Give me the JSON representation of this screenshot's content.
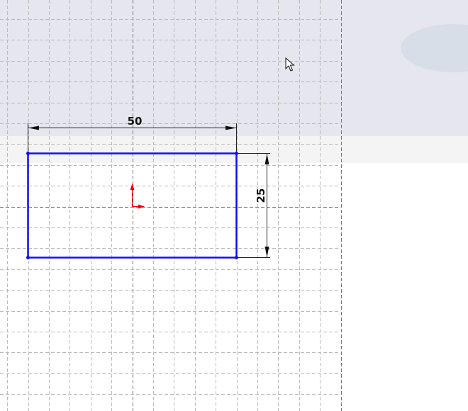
{
  "sketch": {
    "width_dimension": "50",
    "height_dimension": "25",
    "sketch_line_color": "#1010ee",
    "origin_color": "#ee0000",
    "background_color": "#e5e6ee"
  },
  "icons": {
    "cursor": "arrow-pointer-icon",
    "origin": "sketch-origin-icon"
  }
}
